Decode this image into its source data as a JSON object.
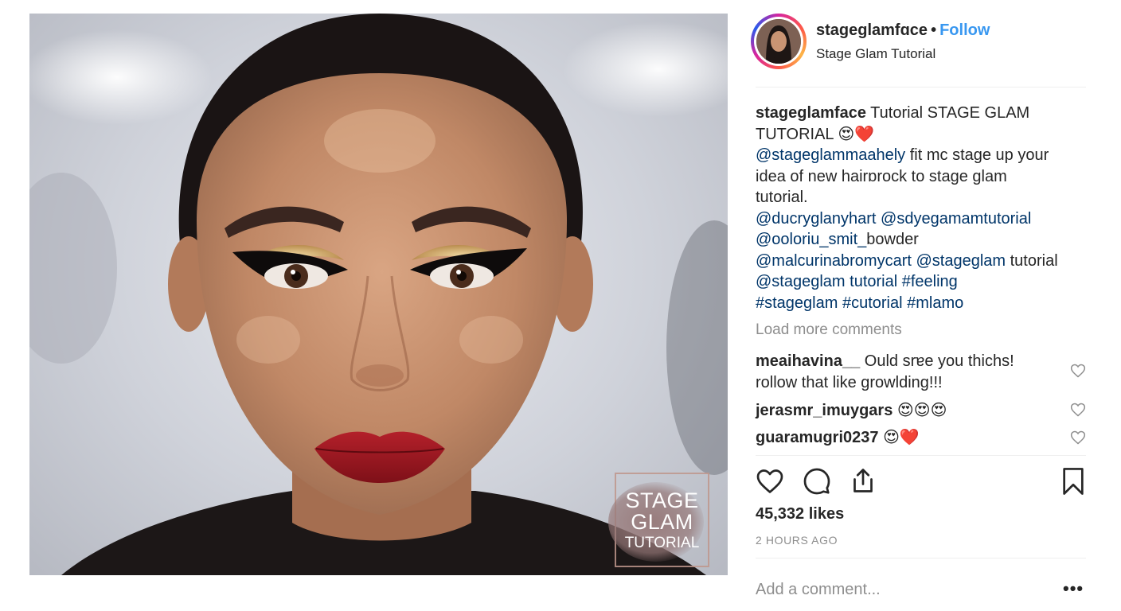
{
  "post": {
    "image_watermark": [
      "STAGE",
      "GLAM",
      "TUTORIAL"
    ]
  },
  "header": {
    "username": "stageglamfɑce",
    "separator": "•",
    "follow_label": "Follow",
    "subtitle": "Stage Glam Tutorial"
  },
  "caption": {
    "username": "stageglamface",
    "text_1": " Tutorial STAGE GLAM",
    "text_2": "TUTORIAL 😍❤️",
    "mention_1": "@stageglammaahely",
    "text_3": " fit mc stage up your",
    "text_4": "idea of new hairɒrock to  stage glam",
    "text_5": "tutorial.",
    "mention_2": "@ducryglanyhart",
    "mention_3": "@sdyegamamtutorial",
    "mention_4": "@ooloriu_smit_",
    "text_6": "bowder",
    "mention_5": "@malcurinabromycart",
    "mention_6": "@stageglam",
    "text_7": " tutorial",
    "mention_7": "@stageglam tutorial #feeling",
    "hashtags": "#stageglam #cutorial #mlamo"
  },
  "load_more_label": "Load more comments",
  "comments": [
    {
      "username": "meaihavina__",
      "text_1": " Ould srɐe you thichs!",
      "text_2": "rollow that like growlding!!!"
    },
    {
      "username": "jerasmr_imuygars",
      "text_1": " 😍😍😍"
    },
    {
      "username": "guaramugri0237",
      "text_1": " 😍❤️"
    }
  ],
  "stats": {
    "likes": "45,332 likes",
    "time_ago": "2 HOURS AGO"
  },
  "add_comment": {
    "placeholder": "Add a comment...",
    "more_label": "•••"
  },
  "icons": {
    "like": "heart-icon",
    "comment": "comment-bubble-icon",
    "share": "share-icon",
    "save": "bookmark-icon",
    "comment_like": "heart-outline-icon"
  },
  "colors": {
    "follow": "#3897f0",
    "mention": "#003569",
    "muted": "#8e8e8e",
    "text": "#262626"
  }
}
